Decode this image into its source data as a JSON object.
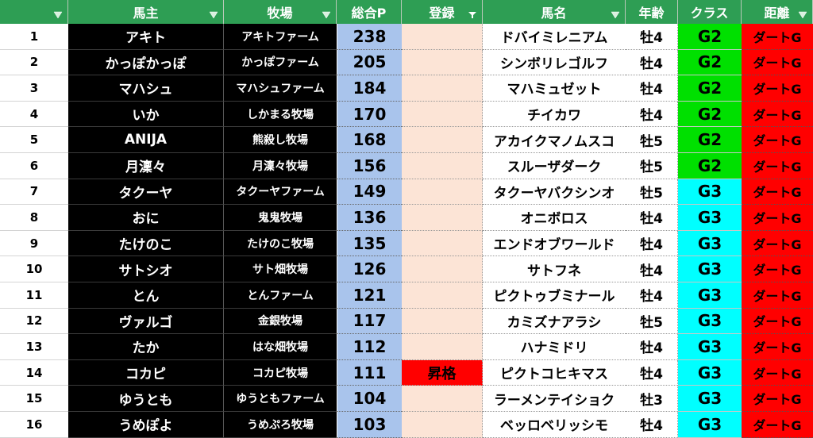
{
  "headers": {
    "num": "",
    "owner": "馬主",
    "farm": "牧場",
    "points": "総合P",
    "registration": "登録",
    "horse": "馬名",
    "age": "年齢",
    "class": "クラス",
    "distance": "距離"
  },
  "colors": {
    "header_bg": "#2e9e54",
    "G2": "#00e000",
    "G3": "#00ffff",
    "points_bg": "#a9c4ec",
    "registration_bg": "#fce4d6",
    "promotion_bg": "#ff0000",
    "distance_bg": "#ff0000"
  },
  "rows": [
    {
      "num": "1",
      "owner": "アキト",
      "farm": "アキトファーム",
      "points": "238",
      "registration": "",
      "horse": "ドバイミレニアム",
      "age": "牡4",
      "class": "G2",
      "distance": "ダートG"
    },
    {
      "num": "2",
      "owner": "かっぽかっぽ",
      "farm": "かっぽファーム",
      "points": "205",
      "registration": "",
      "horse": "シンボリレゴルフ",
      "age": "牡4",
      "class": "G2",
      "distance": "ダートG"
    },
    {
      "num": "3",
      "owner": "マハシュ",
      "farm": "マハシュファーム",
      "points": "184",
      "registration": "",
      "horse": "マハミュゼット",
      "age": "牡4",
      "class": "G2",
      "distance": "ダートG"
    },
    {
      "num": "4",
      "owner": "いか",
      "farm": "しかまる牧場",
      "points": "170",
      "registration": "",
      "horse": "チイカワ",
      "age": "牡4",
      "class": "G2",
      "distance": "ダートG"
    },
    {
      "num": "5",
      "owner": "ANIJA",
      "farm": "熊殺し牧場",
      "points": "168",
      "registration": "",
      "horse": "アカイクマノムスコ",
      "age": "牡5",
      "class": "G2",
      "distance": "ダートG"
    },
    {
      "num": "6",
      "owner": "月澟々",
      "farm": "月澟々牧場",
      "points": "156",
      "registration": "",
      "horse": "スルーザダーク",
      "age": "牡5",
      "class": "G2",
      "distance": "ダートG"
    },
    {
      "num": "7",
      "owner": "タクーヤ",
      "farm": "タクーヤファーム",
      "points": "149",
      "registration": "",
      "horse": "タクーヤバクシンオ",
      "age": "牡5",
      "class": "G3",
      "distance": "ダートG"
    },
    {
      "num": "8",
      "owner": "おに",
      "farm": "鬼鬼牧場",
      "points": "136",
      "registration": "",
      "horse": "オニボロス",
      "age": "牡4",
      "class": "G3",
      "distance": "ダートG"
    },
    {
      "num": "9",
      "owner": "たけのこ",
      "farm": "たけのこ牧場",
      "points": "135",
      "registration": "",
      "horse": "エンドオブワールド",
      "age": "牡4",
      "class": "G3",
      "distance": "ダートG"
    },
    {
      "num": "10",
      "owner": "サトシオ",
      "farm": "サト畑牧場",
      "points": "126",
      "registration": "",
      "horse": "サトフネ",
      "age": "牡4",
      "class": "G3",
      "distance": "ダートG"
    },
    {
      "num": "11",
      "owner": "とん",
      "farm": "とんファーム",
      "points": "121",
      "registration": "",
      "horse": "ピクトゥブミナール",
      "age": "牡4",
      "class": "G3",
      "distance": "ダートG"
    },
    {
      "num": "12",
      "owner": "ヴァルゴ",
      "farm": "金銀牧場",
      "points": "117",
      "registration": "",
      "horse": "カミズナアラシ",
      "age": "牡5",
      "class": "G3",
      "distance": "ダートG"
    },
    {
      "num": "13",
      "owner": "たか",
      "farm": "はな畑牧場",
      "points": "112",
      "registration": "",
      "horse": "ハナミドリ",
      "age": "牡4",
      "class": "G3",
      "distance": "ダートG"
    },
    {
      "num": "14",
      "owner": "コカピ",
      "farm": "コカピ牧場",
      "points": "111",
      "registration": "昇格",
      "horse": "ピクトコヒキマス",
      "age": "牡4",
      "class": "G3",
      "distance": "ダートG"
    },
    {
      "num": "15",
      "owner": "ゆうとも",
      "farm": "ゆうともファーム",
      "points": "104",
      "registration": "",
      "horse": "ラーメンテイショク",
      "age": "牡3",
      "class": "G3",
      "distance": "ダートG"
    },
    {
      "num": "16",
      "owner": "うめぽよ",
      "farm": "うめぷろ牧場",
      "points": "103",
      "registration": "",
      "horse": "ベッロベリッシモ",
      "age": "牡4",
      "class": "G3",
      "distance": "ダートG"
    }
  ]
}
